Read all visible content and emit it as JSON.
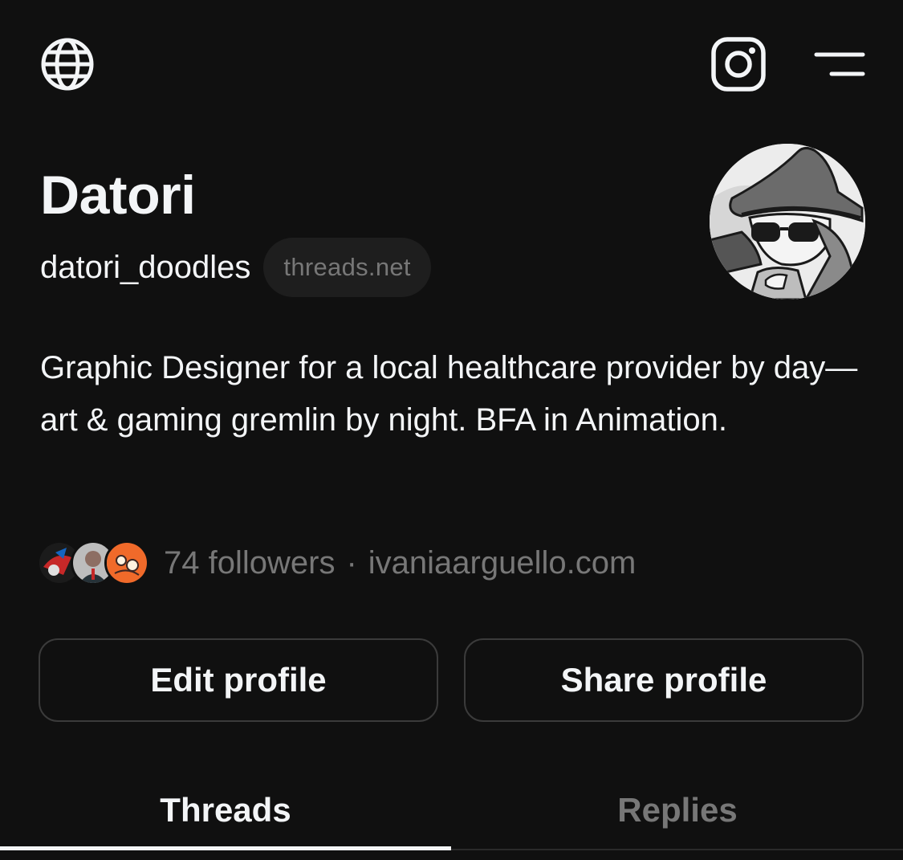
{
  "header": {
    "globe_icon": "globe-icon",
    "instagram_icon": "instagram-icon",
    "menu_icon": "menu-icon"
  },
  "profile": {
    "name": "Datori",
    "handle": "datori_doodles",
    "domain_badge": "threads.net",
    "bio": "Graphic Designer for a local healthcare provider by day—art & gaming gremlin by night. BFA in Animation.",
    "followers": "74 followers",
    "separator": "·",
    "website": "ivaniaarguello.com"
  },
  "actions": {
    "edit_label": "Edit profile",
    "share_label": "Share profile"
  },
  "tabs": [
    {
      "label": "Threads",
      "active": true
    },
    {
      "label": "Replies",
      "active": false
    }
  ],
  "colors": {
    "background": "#101010",
    "text_primary": "#f3f5f7",
    "text_secondary": "#777777",
    "border": "#3b3b3b"
  }
}
